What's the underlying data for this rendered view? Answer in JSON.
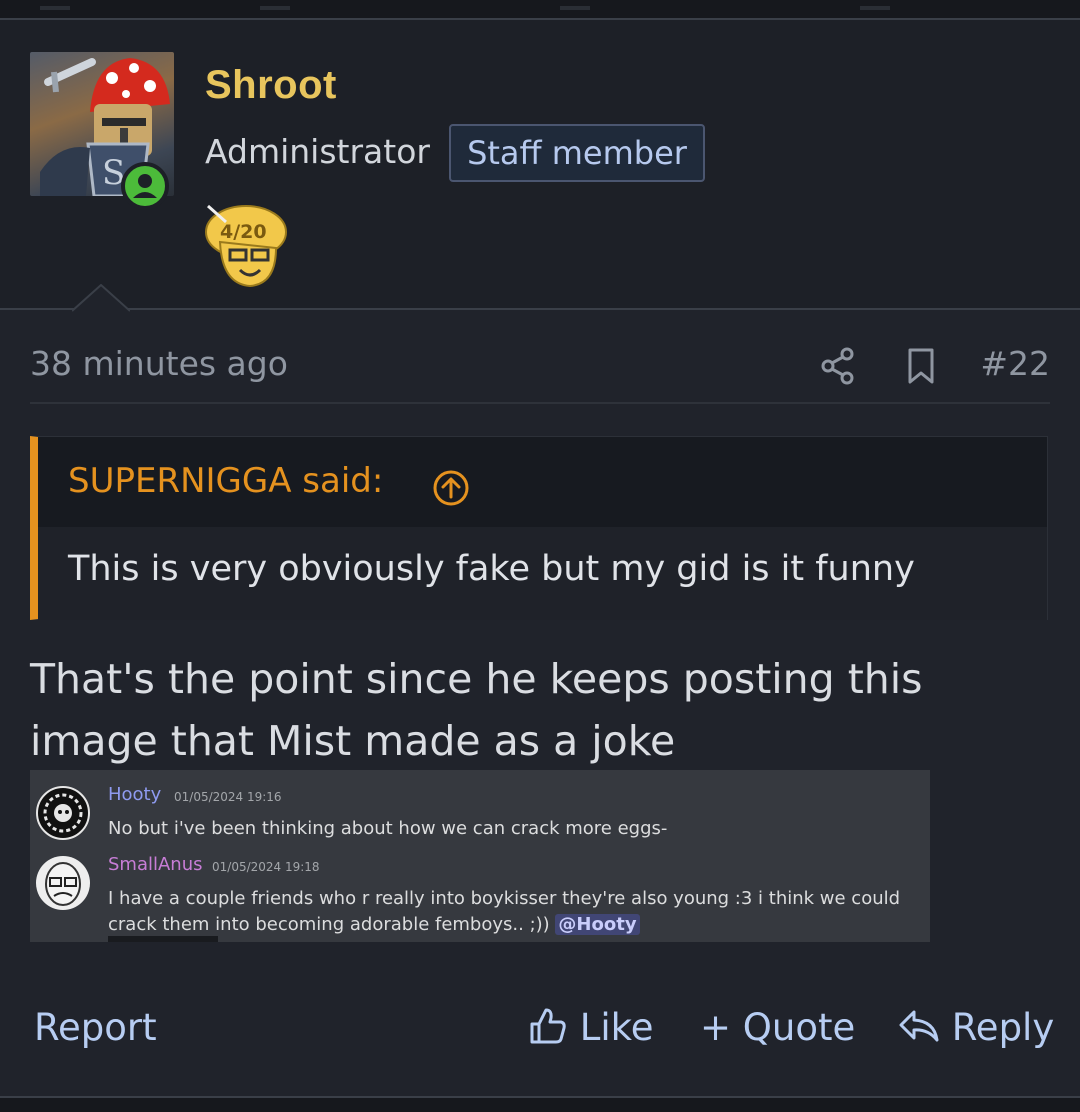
{
  "post": {
    "author": {
      "username": "Shroot",
      "role": "Administrator",
      "staff_badge": "Staff member",
      "username_color": "#e8c55d",
      "online_status_color": "#4cbb3a",
      "trophy_label": "4/20"
    },
    "meta": {
      "timestamp": "38 minutes ago",
      "post_number": "#22"
    },
    "quote": {
      "author_line": "SUPERNIGGA said:",
      "text": "This is very obviously fake but my gid is it funny",
      "accent_color": "#e5921f"
    },
    "message": "That's the point since he keeps posting this image that Mist made as a joke",
    "embedded_image": {
      "messages": [
        {
          "name": "Hooty",
          "name_color": "#8f9bf0",
          "time": "01/05/2024 19:16",
          "text": "No but i've been thinking about how we can crack more eggs-"
        },
        {
          "name": "SmallAnus",
          "name_color": "#c77dd6",
          "time": "01/05/2024 19:18",
          "text": "I have a couple friends who r really into boykisser they're also young :3 i think we could crack them into becoming adorable femboys.. ;))",
          "mention": "@Hooty"
        }
      ]
    },
    "actions": {
      "report": "Report",
      "like": "Like",
      "quote": "+ Quote",
      "reply": "Reply"
    }
  }
}
